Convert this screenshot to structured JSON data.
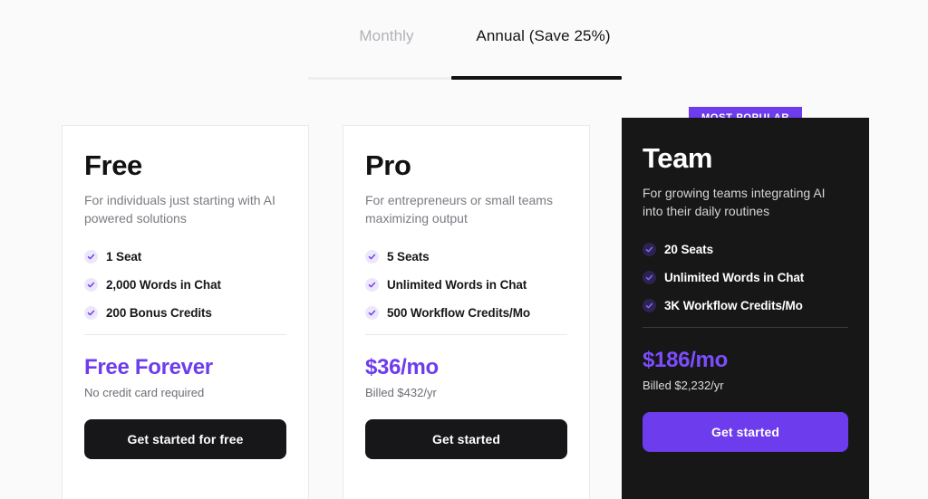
{
  "billing_tabs": {
    "options": [
      {
        "label": "Monthly",
        "active": false
      },
      {
        "label": "Annual (Save 25%)",
        "active": true
      }
    ]
  },
  "accent_colors": {
    "purple": "#6d3cec",
    "purple_light": "#7c4dff",
    "dark": "#17171a",
    "page_background": "#fafafa",
    "check_bubble_light": "#ece7fc",
    "check_bubble_dark": "#2c2350"
  },
  "plans": {
    "free": {
      "name": "Free",
      "description": "For individuals just starting with AI powered solutions",
      "features": [
        "1 Seat",
        "2,000 Words in Chat",
        "200 Bonus Credits"
      ],
      "price": "Free Forever",
      "price_note": "No credit card required",
      "cta_label": "Get started for free"
    },
    "pro": {
      "name": "Pro",
      "description": "For entrepreneurs or small teams maximizing output",
      "features": [
        "5 Seats",
        "Unlimited Words in Chat",
        "500 Workflow Credits/Mo"
      ],
      "price": "$36/mo",
      "price_note": "Billed $432/yr",
      "cta_label": "Get started"
    },
    "team": {
      "badge": "MOST POPULAR",
      "name": "Team",
      "description": "For growing teams integrating AI into their daily routines",
      "features": [
        "20 Seats",
        "Unlimited Words in Chat",
        "3K Workflow Credits/Mo"
      ],
      "price": "$186/mo",
      "price_note": "Billed $2,232/yr",
      "cta_label": "Get started"
    }
  }
}
